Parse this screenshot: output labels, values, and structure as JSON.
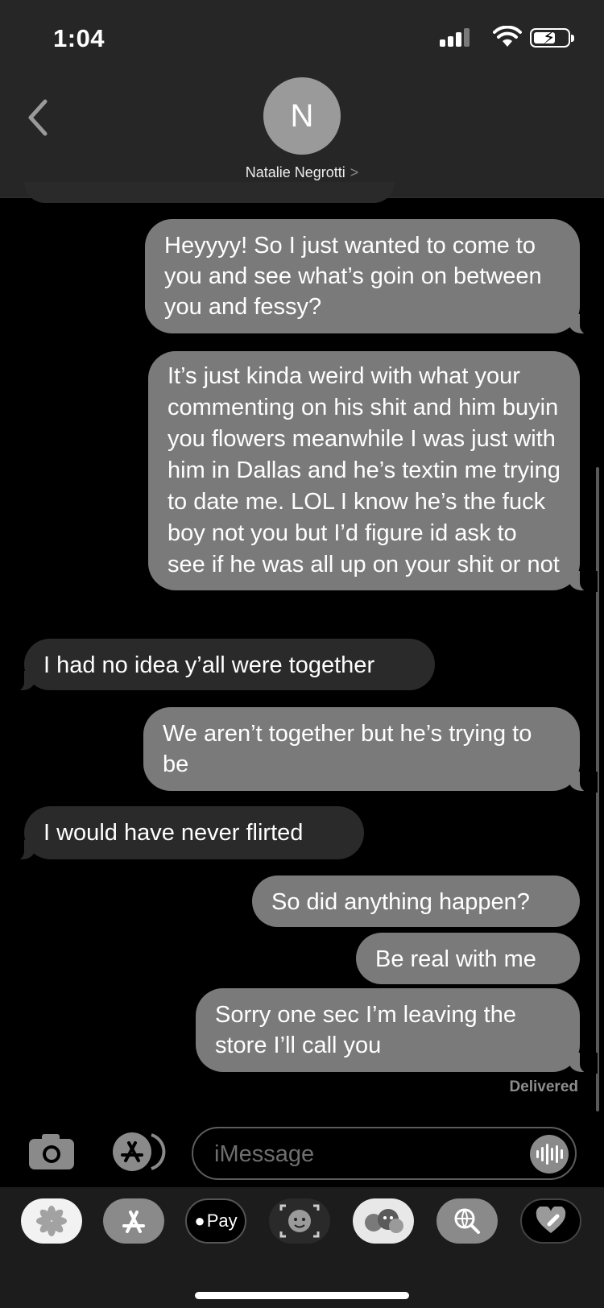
{
  "status_bar": {
    "time": "1:04"
  },
  "header": {
    "avatar_initial": "N",
    "contact_name": "Natalie Negrotti",
    "name_chevron": ">"
  },
  "messages": [
    {
      "side": "out",
      "text": "Heyyyy! So I just wanted to come to you and see what’s goin on between you and fessy?"
    },
    {
      "side": "out",
      "text": "It’s just kinda weird with what your commenting on his shit and him buyin you flowers meanwhile I was just with him in Dallas and he’s textin me trying to date me. LOL I know he’s the fuck boy not you but I’d figure id ask to see if he was all up on your shit or not"
    },
    {
      "side": "in",
      "text": "I had no idea y’all were together"
    },
    {
      "side": "out",
      "text": "We aren’t together but he’s trying to be"
    },
    {
      "side": "in",
      "text": "I would have never flirted"
    },
    {
      "side": "out",
      "text": "So did anything happen?"
    },
    {
      "side": "out",
      "text": "Be real with me"
    },
    {
      "side": "out",
      "text": "Sorry one sec I’m leaving the store I’ll call you"
    }
  ],
  "delivered_label": "Delivered",
  "input": {
    "placeholder": "iMessage"
  },
  "tray": {
    "apple_pay_label": "Pay"
  },
  "colors": {
    "outgoing_bubble": "#7a7a7a",
    "incoming_bubble": "#2a2a2a",
    "header_bg": "#262626"
  }
}
